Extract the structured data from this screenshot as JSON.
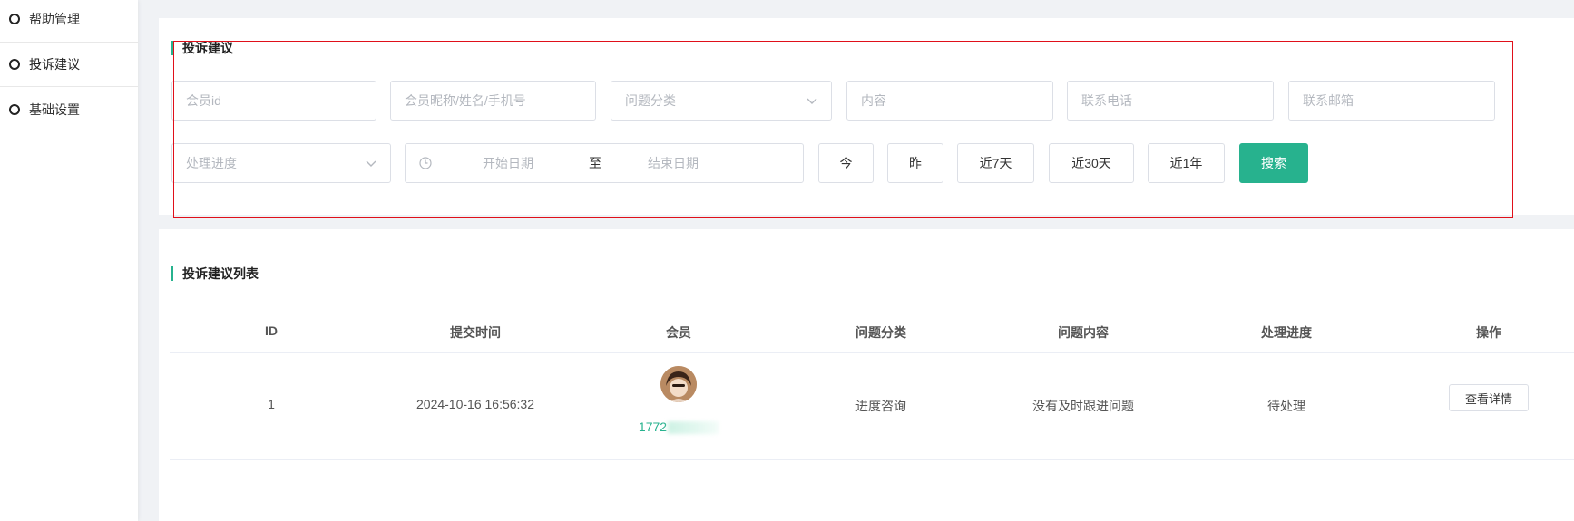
{
  "sidebar": {
    "items": [
      {
        "label": "帮助管理"
      },
      {
        "label": "投诉建议"
      },
      {
        "label": "基础设置"
      }
    ]
  },
  "search": {
    "title": "投诉建议",
    "member_id_placeholder": "会员id",
    "member_name_placeholder": "会员昵称/姓名/手机号",
    "category_placeholder": "问题分类",
    "content_placeholder": "内容",
    "phone_placeholder": "联系电话",
    "email_placeholder": "联系邮箱",
    "status_placeholder": "处理进度",
    "start_date_placeholder": "开始日期",
    "range_separator": "至",
    "end_date_placeholder": "结束日期",
    "btn_today": "今",
    "btn_yesterday": "昨",
    "btn_7days": "近7天",
    "btn_30days": "近30天",
    "btn_1year": "近1年",
    "btn_search": "搜索"
  },
  "list": {
    "title": "投诉建议列表",
    "columns": [
      "ID",
      "提交时间",
      "会员",
      "问题分类",
      "问题内容",
      "处理进度",
      "操作"
    ],
    "rows": [
      {
        "id": "1",
        "submit_time": "2024-10-16 16:56:32",
        "member_id": "1772",
        "category": "进度咨询",
        "content": "没有及时跟进问题",
        "status": "待处理",
        "action": "查看详情"
      }
    ]
  },
  "colors": {
    "accent": "#27b28e",
    "highlight": "#e0101a"
  }
}
